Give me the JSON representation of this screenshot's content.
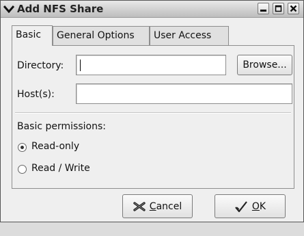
{
  "window": {
    "title": "Add NFS Share"
  },
  "tabs": [
    {
      "label": "Basic",
      "active": true
    },
    {
      "label": "General Options",
      "active": false
    },
    {
      "label": "User Access",
      "active": false
    }
  ],
  "directory": {
    "label": "Directory:",
    "value": "",
    "browse_label": "Browse..."
  },
  "hosts": {
    "label": "Host(s):",
    "value": ""
  },
  "permissions": {
    "heading": "Basic permissions:",
    "options": [
      {
        "label": "Read-only",
        "selected": true
      },
      {
        "label": "Read / Write",
        "selected": false
      }
    ]
  },
  "actions": {
    "cancel": {
      "mnemonic": "C",
      "rest": "ancel"
    },
    "ok": {
      "mnemonic": "O",
      "rest": "K"
    }
  },
  "icons": {
    "menu": "chevron-down-icon",
    "minimize": "minimize-icon",
    "maximize": "maximize-icon",
    "close": "close-icon",
    "cancel": "cancel-icon",
    "ok": "checkmark-icon"
  }
}
